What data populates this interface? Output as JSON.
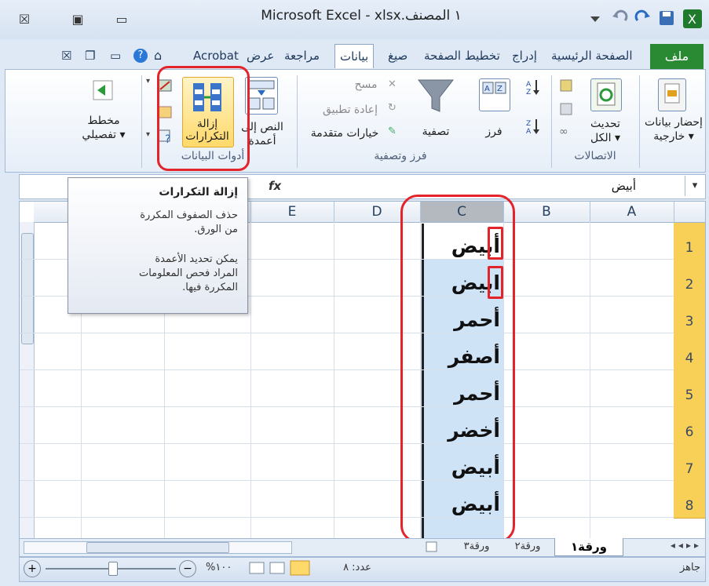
{
  "window": {
    "title": "Microsoft Excel - xlsx.١ المصنف",
    "buttons": {
      "close": "☒",
      "restore": "▣",
      "minimize": "▭"
    }
  },
  "quick_access": {
    "save_icon": "save-icon",
    "undo_icon": "undo-icon",
    "redo_icon": "redo-icon"
  },
  "tabs": {
    "file": "ملف",
    "home": "الصفحة الرئيسية",
    "insert": "إدراج",
    "page_layout": "تخطيط الصفحة",
    "formulas": "صيغ",
    "data": "بيانات",
    "review": "مراجعة",
    "view": "عرض",
    "acrobat": "Acrobat"
  },
  "ribbon": {
    "external_data": {
      "label1": "إحضار بيانات",
      "label2": "خارجية ▾"
    },
    "connections": {
      "refresh1": "تحديث",
      "refresh2": "الكل ▾",
      "group": "الاتصالات"
    },
    "sort_filter": {
      "sort": "فرز",
      "filter": "تصفية",
      "clear": "مسح",
      "reapply": "إعادة تطبيق",
      "advanced": "خيارات متقدمة",
      "group": "فرز وتصفية"
    },
    "data_tools": {
      "text_to_columns1": "النص إلى",
      "text_to_columns2": "أعمدة",
      "remove_dup1": "إزالة",
      "remove_dup2": "التكرارات",
      "group": "أدوات البيانات"
    },
    "outline": {
      "label1": "مخطط",
      "label2": "تفصيلي ▾"
    }
  },
  "formula_bar": {
    "name_box": "",
    "fx": "fx",
    "value": "أبيض",
    "dropdown": "▾"
  },
  "tooltip": {
    "title": "إزالة التكرارات",
    "line1": "حذف الصفوف المكررة",
    "line2": "من الورق.",
    "line3": "يمكن تحديد الأعمدة",
    "line4": "المراد فحص المعلومات",
    "line5": "المكررة فيها."
  },
  "grid": {
    "columns": [
      "A",
      "B",
      "C",
      "D",
      "E"
    ],
    "rows": [
      "1",
      "2",
      "3",
      "4",
      "5",
      "6",
      "7",
      "8"
    ],
    "c_values": [
      "أبيض",
      "ابيض",
      "أحمر",
      "أصفر",
      "أحمر",
      "أخضر",
      "أبيض",
      "أبيض"
    ]
  },
  "sheets": [
    "ورقة١",
    "ورقة٢",
    "ورقة٣"
  ],
  "status": {
    "ready": "جاهز",
    "count": "عدد: ٨",
    "zoom": "%١٠٠",
    "zoom_minus": "−",
    "zoom_plus": "+"
  },
  "accent": {
    "file_tab": "#2a8a34",
    "highlight": "#e3242b",
    "row_header": "#f8cf57",
    "selection": "#cfe3f7"
  }
}
